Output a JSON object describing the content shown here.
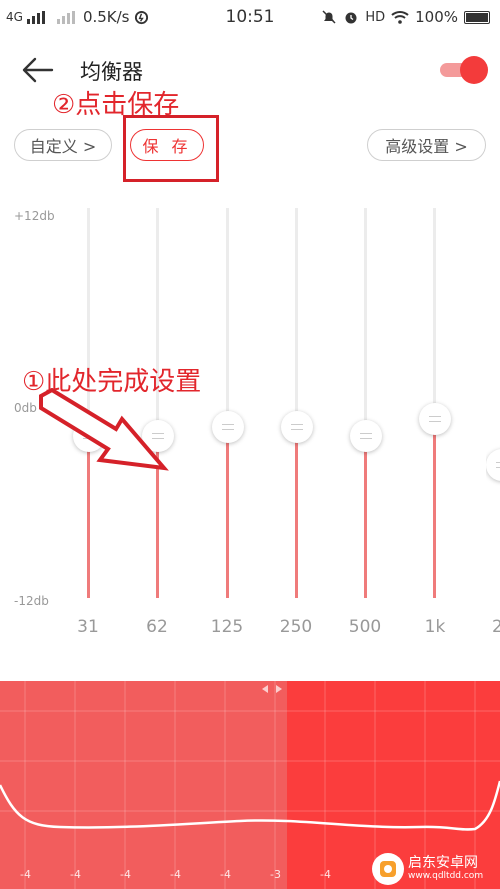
{
  "status_bar": {
    "network": "4G",
    "speed": "0.5K/s",
    "time": "10:51",
    "hd": "HD",
    "battery": "100%"
  },
  "header": {
    "title": "均衡器",
    "toggle_on": true
  },
  "annotations": {
    "step2": "②点击保存",
    "step1": "①此处完成设置"
  },
  "buttons": {
    "preset": "自定义 >",
    "save": "保 存",
    "advanced": "高级设置 >"
  },
  "db_scale": {
    "top": "+12db",
    "mid": "0db",
    "bottom": "-12db"
  },
  "bands": [
    {
      "label": "31",
      "level_db": -2
    },
    {
      "label": "62",
      "level_db": -2
    },
    {
      "label": "125",
      "level_db": -1.5
    },
    {
      "label": "250",
      "level_db": -1.5
    },
    {
      "label": "500",
      "level_db": -2
    },
    {
      "label": "1k",
      "level_db": -1
    }
  ],
  "graph": {
    "x_ticks": [
      "-4",
      "-4",
      "-4",
      "-4",
      "-4",
      "-3",
      "-4"
    ],
    "colors": {
      "left": "#f25d5d",
      "right": "#fb3d3d"
    }
  },
  "watermark": {
    "name": "启东安卓网",
    "url": "www.qdltdd.com"
  },
  "colors": {
    "accent": "#f33b3b",
    "annotation": "#e2262c"
  }
}
